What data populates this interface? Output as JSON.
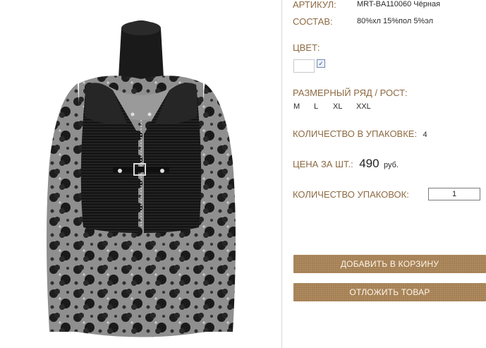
{
  "product": {
    "sku_label": "АРТИКУЛ:",
    "sku_value": "MRT-BA110060 Чёрная",
    "composition_label": "СОСТАВ:",
    "composition_value": "80%хл 15%пол 5%эл",
    "color_label": "ЦВЕТ:",
    "color_swatch": "#ffffff",
    "color_checked": "✓",
    "size_label": "РАЗМЕРНЫЙ РЯД / РОСТ:",
    "sizes": [
      "M",
      "L",
      "XL",
      "XXL"
    ],
    "pack_qty_label": "КОЛИЧЕСТВО В УПАКОВКЕ:",
    "pack_qty_value": "4",
    "price_label": "ЦЕНА ЗА ШТ.:",
    "price_value": "490",
    "price_currency": "руб.",
    "packs_label": "КОЛИЧЕСТВО УПАКОВОК:",
    "packs_value": "1"
  },
  "actions": {
    "add_to_cart": "ДОБАВИТЬ В КОРЗИНУ",
    "defer": "ОТЛОЖИТЬ ТОВАР"
  },
  "colors": {
    "label_brown": "#8d6a42",
    "button_brown": "#a27b4d"
  }
}
